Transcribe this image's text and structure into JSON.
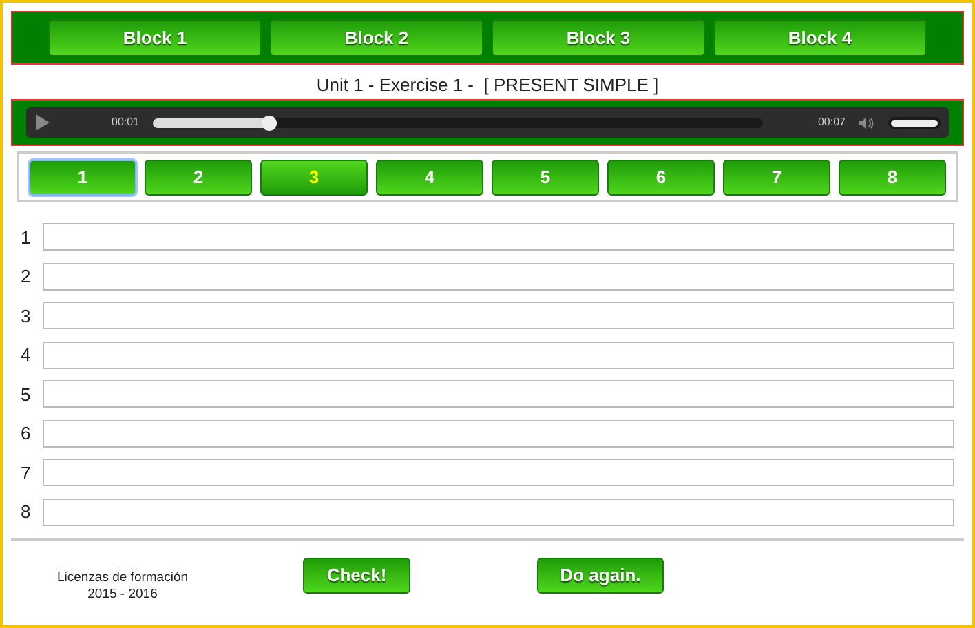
{
  "blocks": [
    {
      "label": "Block 1"
    },
    {
      "label": "Block 2"
    },
    {
      "label": "Block 3"
    },
    {
      "label": "Block 4"
    }
  ],
  "title": "Unit 1 - Exercise 1 -  [ PRESENT SIMPLE ]",
  "player": {
    "current_time": "00:01",
    "total_time": "00:07",
    "level": 0.19,
    "volume": {
      "level": 1
    }
  },
  "questions": [
    {
      "label": "1",
      "selected": false,
      "focused": true
    },
    {
      "label": "2",
      "selected": false,
      "focused": false
    },
    {
      "label": "3",
      "selected": true,
      "focused": false
    },
    {
      "label": "4",
      "selected": false,
      "focused": false
    },
    {
      "label": "5",
      "selected": false,
      "focused": false
    },
    {
      "label": "6",
      "selected": false,
      "focused": false
    },
    {
      "label": "7",
      "selected": false,
      "focused": false
    },
    {
      "label": "8",
      "selected": false,
      "focused": false
    }
  ],
  "answers": [
    {
      "number": "1"
    },
    {
      "number": "2"
    },
    {
      "number": "3"
    },
    {
      "number": "4"
    },
    {
      "number": "5"
    },
    {
      "number": "6"
    },
    {
      "number": "7"
    },
    {
      "number": "8"
    }
  ],
  "footer": {
    "credit_lines": [
      "Licenzas de formación",
      "2015 - 2016"
    ],
    "buttons": [
      {
        "label": "Check!"
      },
      {
        "label": "Do again."
      }
    ]
  }
}
